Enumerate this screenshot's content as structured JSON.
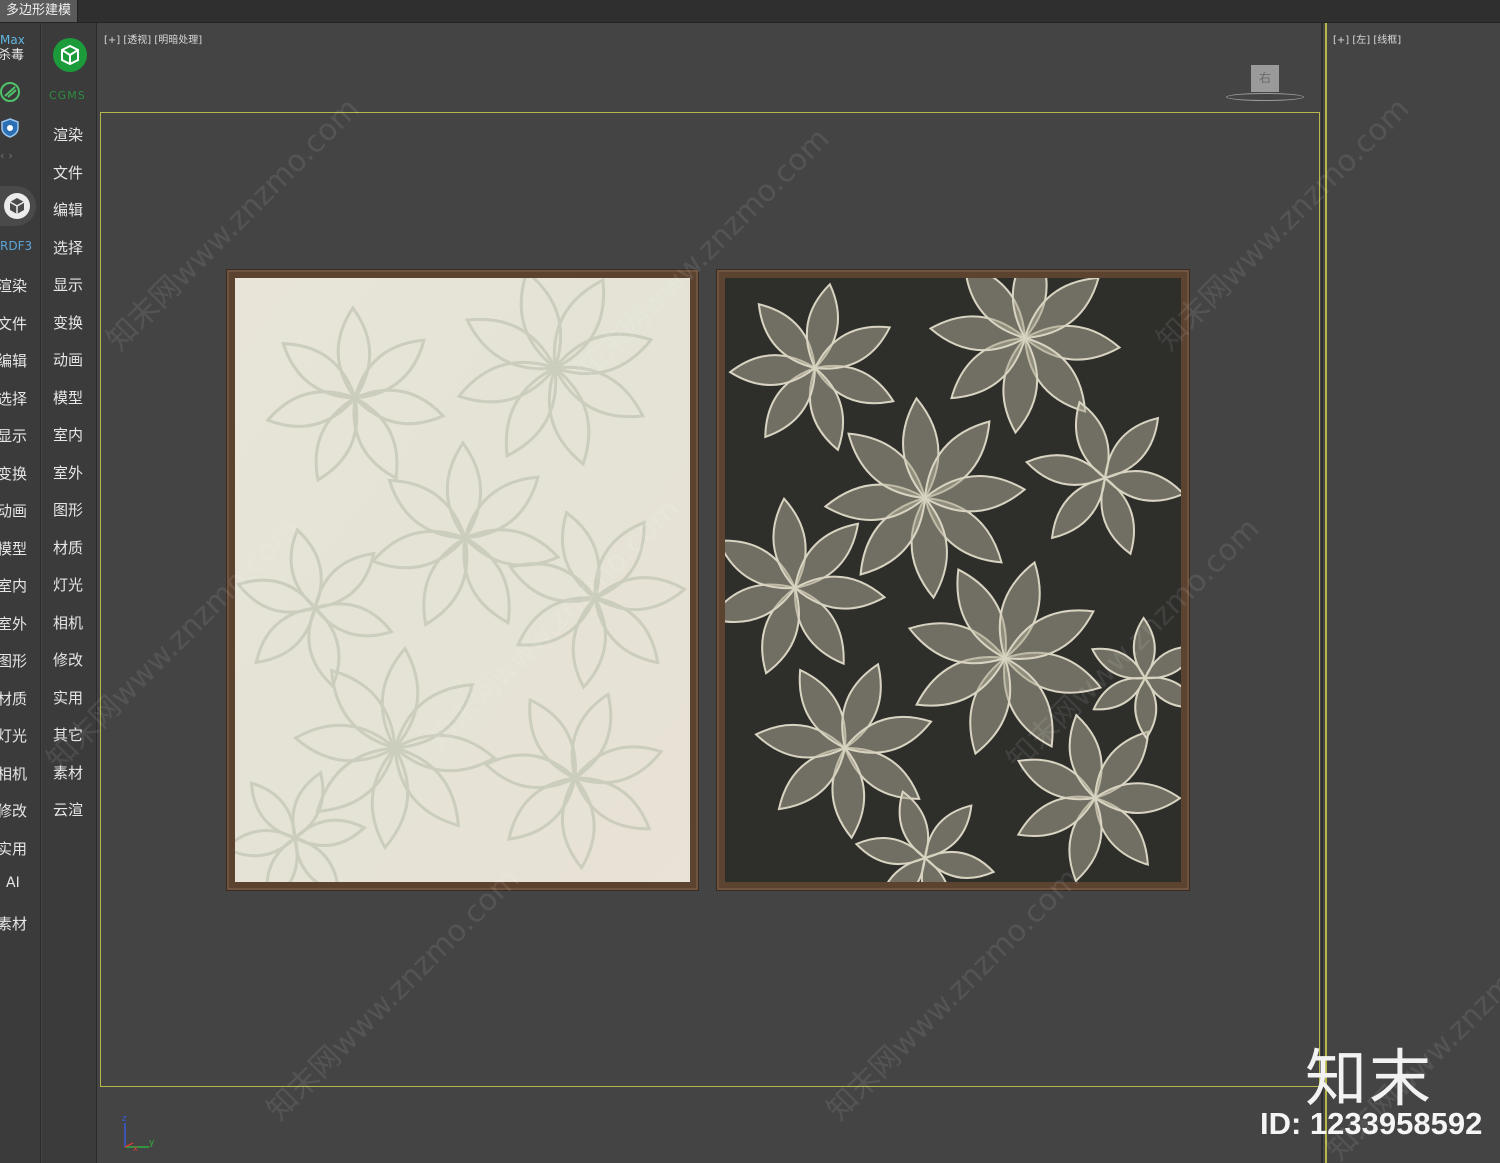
{
  "ribbon": {
    "active_tab": "多边形建模"
  },
  "left_column": {
    "badge_line1": "Max",
    "badge_line2": "杀毒",
    "plugin_label": "RDF3",
    "menu_items": [
      "渲染",
      "文件",
      "编辑",
      "选择",
      "显示",
      "变换",
      "动画",
      "模型",
      "室内",
      "室外",
      "图形",
      "材质",
      "灯光",
      "相机",
      "修改",
      "实用",
      "AI",
      "素材"
    ]
  },
  "mid_column": {
    "logo_label": "CGMS",
    "menu_items": [
      "渲染",
      "文件",
      "编辑",
      "选择",
      "显示",
      "变换",
      "动画",
      "模型",
      "室内",
      "室外",
      "图形",
      "材质",
      "灯光",
      "相机",
      "修改",
      "实用",
      "其它",
      "素材",
      "云渲"
    ]
  },
  "viewport_main": {
    "label": "[+] [透视] [明暗处理]",
    "viewcube_face": "右",
    "axis_z": "z",
    "axis_y": "y",
    "axis_x": "x"
  },
  "viewport_right": {
    "label": "[+] [左] [线框]"
  },
  "watermark": {
    "text": "知末网www.znzmo.com",
    "brand": "知末",
    "id_text": "ID: 1233958592"
  },
  "colors": {
    "viewport_bg": "#444444",
    "safe_frame": "#b8b84a",
    "frame_wood": "#5c4330",
    "left_canvas": "#e9e6da",
    "right_canvas": "#2e2e2b",
    "cgms_green": "#1c9b3a"
  }
}
